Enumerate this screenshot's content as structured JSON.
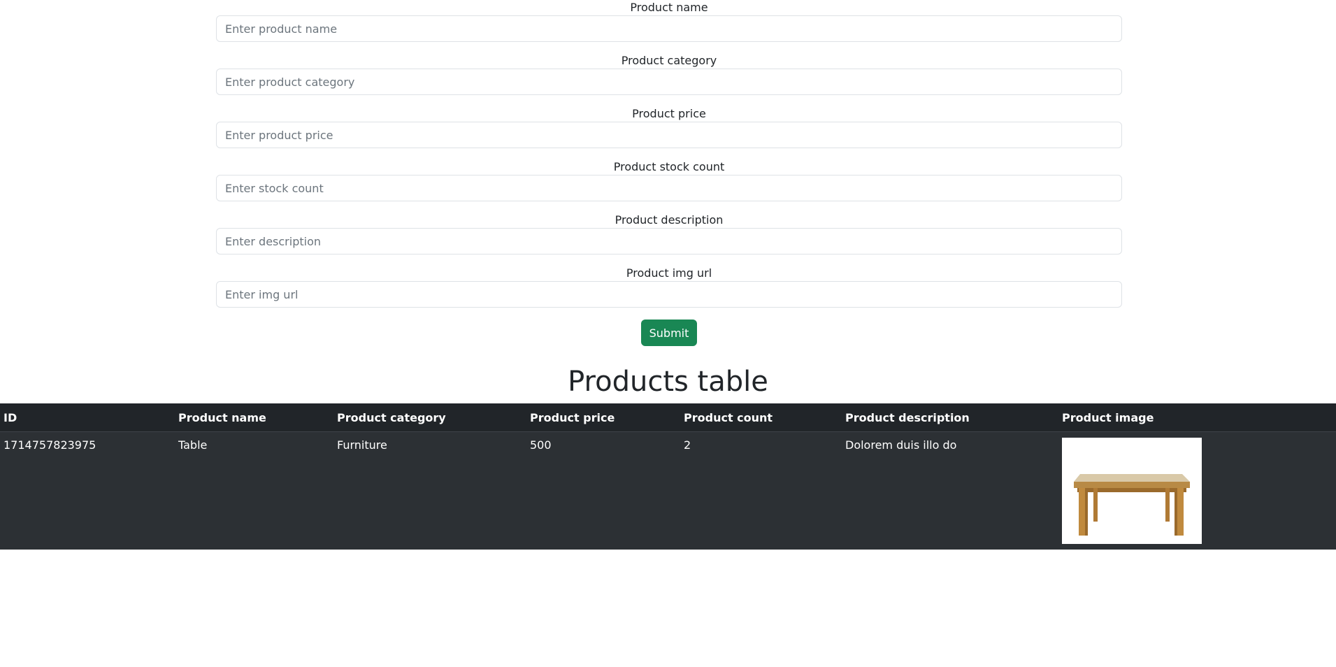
{
  "form": {
    "fields": [
      {
        "label": "Product name",
        "placeholder": "Enter product name",
        "value": ""
      },
      {
        "label": "Product category",
        "placeholder": "Enter product category",
        "value": ""
      },
      {
        "label": "Product price",
        "placeholder": "Enter product price",
        "value": ""
      },
      {
        "label": "Product stock count",
        "placeholder": "Enter stock count",
        "value": ""
      },
      {
        "label": "Product description",
        "placeholder": "Enter description",
        "value": ""
      },
      {
        "label": "Product img url",
        "placeholder": "Enter img url",
        "value": ""
      }
    ],
    "submit_label": "Submit",
    "submit_color": "#198754"
  },
  "table": {
    "title": "Products table",
    "columns": [
      "ID",
      "Product name",
      "Product category",
      "Product price",
      "Product count",
      "Product description",
      "Product image"
    ],
    "rows": [
      {
        "id": "1714757823975",
        "name": "Table",
        "category": "Furniture",
        "price": "500",
        "count": "2",
        "description": "Dolorem duis illo do",
        "image": "wooden-table-image"
      }
    ],
    "header_bg": "#212529",
    "row_bg": "#2c3034"
  }
}
